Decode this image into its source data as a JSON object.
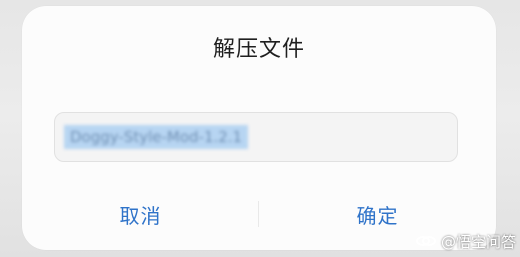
{
  "dialog": {
    "title": "解压文件",
    "filename_value": "Doggy-Style-Mod-1.2.1",
    "cancel_label": "取消",
    "confirm_label": "确定"
  },
  "watermark": {
    "text": "@悟空问答",
    "icon": "wukong-logo-icon"
  },
  "colors": {
    "accent": "#2f73c9",
    "selection": "#b7d5f2",
    "dialog_background": "#fcfcfc"
  }
}
